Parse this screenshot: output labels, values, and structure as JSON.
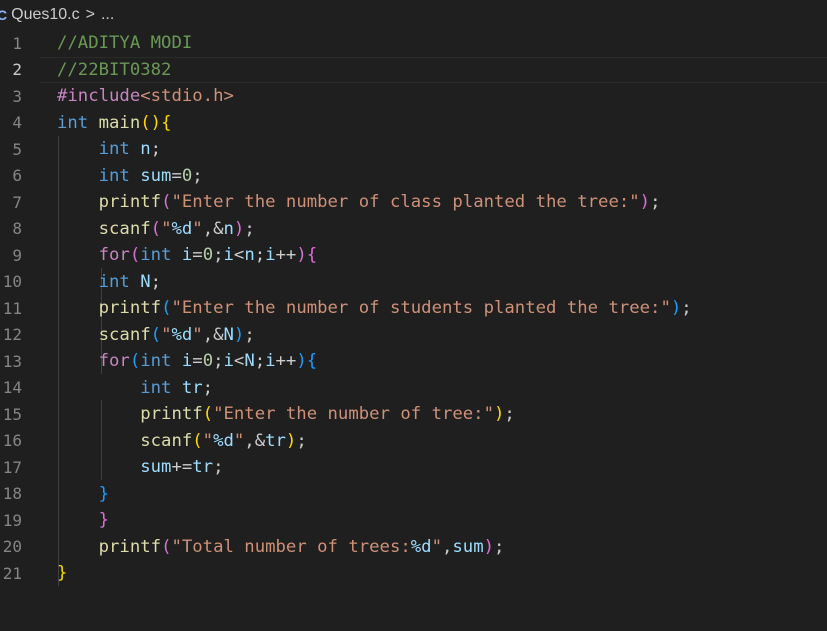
{
  "breadcrumb": {
    "icon": "c-file-icon",
    "icon_glyph": "C",
    "file": "Ques10.c",
    "separator": ">",
    "more": "..."
  },
  "editor": {
    "current_line": 2,
    "lines": [
      {
        "num": "1",
        "tokens": [
          {
            "t": "//ADITYA MODI",
            "c": "t-comment"
          }
        ]
      },
      {
        "num": "2",
        "tokens": [
          {
            "t": "//22BIT0382",
            "c": "t-comment"
          }
        ]
      },
      {
        "num": "3",
        "tokens": [
          {
            "t": "#include",
            "c": "t-inc"
          },
          {
            "t": "<stdio.h>",
            "c": "t-str"
          }
        ]
      },
      {
        "num": "4",
        "tokens": [
          {
            "t": "int",
            "c": "t-kw"
          },
          {
            "t": " ",
            "c": "t-punc"
          },
          {
            "t": "main",
            "c": "t-fn"
          },
          {
            "t": "()",
            "c": "t-br1"
          },
          {
            "t": "{",
            "c": "t-br1"
          }
        ]
      },
      {
        "num": "5",
        "tokens": [
          {
            "t": "    ",
            "c": "t-punc"
          },
          {
            "t": "int",
            "c": "t-kw"
          },
          {
            "t": " ",
            "c": "t-punc"
          },
          {
            "t": "n",
            "c": "t-var"
          },
          {
            "t": ";",
            "c": "t-punc"
          }
        ]
      },
      {
        "num": "6",
        "tokens": [
          {
            "t": "    ",
            "c": "t-punc"
          },
          {
            "t": "int",
            "c": "t-kw"
          },
          {
            "t": " ",
            "c": "t-punc"
          },
          {
            "t": "sum",
            "c": "t-var"
          },
          {
            "t": "=",
            "c": "t-punc"
          },
          {
            "t": "0",
            "c": "t-num"
          },
          {
            "t": ";",
            "c": "t-punc"
          }
        ]
      },
      {
        "num": "7",
        "tokens": [
          {
            "t": "    ",
            "c": "t-punc"
          },
          {
            "t": "printf",
            "c": "t-fn"
          },
          {
            "t": "(",
            "c": "t-br2"
          },
          {
            "t": "\"Enter the number of class planted the tree:\"",
            "c": "t-str"
          },
          {
            "t": ")",
            "c": "t-br2"
          },
          {
            "t": ";",
            "c": "t-punc"
          }
        ]
      },
      {
        "num": "8",
        "tokens": [
          {
            "t": "    ",
            "c": "t-punc"
          },
          {
            "t": "scanf",
            "c": "t-fn"
          },
          {
            "t": "(",
            "c": "t-br2"
          },
          {
            "t": "\"",
            "c": "t-str"
          },
          {
            "t": "%d",
            "c": "t-var"
          },
          {
            "t": "\"",
            "c": "t-str"
          },
          {
            "t": ",&",
            "c": "t-punc"
          },
          {
            "t": "n",
            "c": "t-var"
          },
          {
            "t": ")",
            "c": "t-br2"
          },
          {
            "t": ";",
            "c": "t-punc"
          }
        ]
      },
      {
        "num": "9",
        "tokens": [
          {
            "t": "    ",
            "c": "t-punc"
          },
          {
            "t": "for",
            "c": "t-ctrl"
          },
          {
            "t": "(",
            "c": "t-br2"
          },
          {
            "t": "int",
            "c": "t-kw"
          },
          {
            "t": " ",
            "c": "t-punc"
          },
          {
            "t": "i",
            "c": "t-var"
          },
          {
            "t": "=",
            "c": "t-punc"
          },
          {
            "t": "0",
            "c": "t-num"
          },
          {
            "t": ";",
            "c": "t-punc"
          },
          {
            "t": "i",
            "c": "t-var"
          },
          {
            "t": "<",
            "c": "t-punc"
          },
          {
            "t": "n",
            "c": "t-var"
          },
          {
            "t": ";",
            "c": "t-punc"
          },
          {
            "t": "i",
            "c": "t-var"
          },
          {
            "t": "++",
            "c": "t-punc"
          },
          {
            "t": ")",
            "c": "t-br2"
          },
          {
            "t": "{",
            "c": "t-br2"
          }
        ]
      },
      {
        "num": "10",
        "tokens": [
          {
            "t": "    ",
            "c": "t-punc"
          },
          {
            "t": "int",
            "c": "t-kw"
          },
          {
            "t": " ",
            "c": "t-punc"
          },
          {
            "t": "N",
            "c": "t-var"
          },
          {
            "t": ";",
            "c": "t-punc"
          }
        ]
      },
      {
        "num": "11",
        "tokens": [
          {
            "t": "    ",
            "c": "t-punc"
          },
          {
            "t": "printf",
            "c": "t-fn"
          },
          {
            "t": "(",
            "c": "t-br3"
          },
          {
            "t": "\"Enter the number of students planted the tree:\"",
            "c": "t-str"
          },
          {
            "t": ")",
            "c": "t-br3"
          },
          {
            "t": ";",
            "c": "t-punc"
          }
        ]
      },
      {
        "num": "12",
        "tokens": [
          {
            "t": "    ",
            "c": "t-punc"
          },
          {
            "t": "scanf",
            "c": "t-fn"
          },
          {
            "t": "(",
            "c": "t-br3"
          },
          {
            "t": "\"",
            "c": "t-str"
          },
          {
            "t": "%d",
            "c": "t-var"
          },
          {
            "t": "\"",
            "c": "t-str"
          },
          {
            "t": ",&",
            "c": "t-punc"
          },
          {
            "t": "N",
            "c": "t-var"
          },
          {
            "t": ")",
            "c": "t-br3"
          },
          {
            "t": ";",
            "c": "t-punc"
          }
        ]
      },
      {
        "num": "13",
        "tokens": [
          {
            "t": "    ",
            "c": "t-punc"
          },
          {
            "t": "for",
            "c": "t-ctrl"
          },
          {
            "t": "(",
            "c": "t-br3"
          },
          {
            "t": "int",
            "c": "t-kw"
          },
          {
            "t": " ",
            "c": "t-punc"
          },
          {
            "t": "i",
            "c": "t-var"
          },
          {
            "t": "=",
            "c": "t-punc"
          },
          {
            "t": "0",
            "c": "t-num"
          },
          {
            "t": ";",
            "c": "t-punc"
          },
          {
            "t": "i",
            "c": "t-var"
          },
          {
            "t": "<",
            "c": "t-punc"
          },
          {
            "t": "N",
            "c": "t-var"
          },
          {
            "t": ";",
            "c": "t-punc"
          },
          {
            "t": "i",
            "c": "t-var"
          },
          {
            "t": "++",
            "c": "t-punc"
          },
          {
            "t": ")",
            "c": "t-br3"
          },
          {
            "t": "{",
            "c": "t-br3"
          }
        ]
      },
      {
        "num": "14",
        "tokens": [
          {
            "t": "        ",
            "c": "t-punc"
          },
          {
            "t": "int",
            "c": "t-kw"
          },
          {
            "t": " ",
            "c": "t-punc"
          },
          {
            "t": "tr",
            "c": "t-var"
          },
          {
            "t": ";",
            "c": "t-punc"
          }
        ]
      },
      {
        "num": "15",
        "tokens": [
          {
            "t": "        ",
            "c": "t-punc"
          },
          {
            "t": "printf",
            "c": "t-fn"
          },
          {
            "t": "(",
            "c": "t-br1"
          },
          {
            "t": "\"Enter the number of tree:\"",
            "c": "t-str"
          },
          {
            "t": ")",
            "c": "t-br1"
          },
          {
            "t": ";",
            "c": "t-punc"
          }
        ]
      },
      {
        "num": "16",
        "tokens": [
          {
            "t": "        ",
            "c": "t-punc"
          },
          {
            "t": "scanf",
            "c": "t-fn"
          },
          {
            "t": "(",
            "c": "t-br1"
          },
          {
            "t": "\"",
            "c": "t-str"
          },
          {
            "t": "%d",
            "c": "t-var"
          },
          {
            "t": "\"",
            "c": "t-str"
          },
          {
            "t": ",&",
            "c": "t-punc"
          },
          {
            "t": "tr",
            "c": "t-var"
          },
          {
            "t": ")",
            "c": "t-br1"
          },
          {
            "t": ";",
            "c": "t-punc"
          }
        ]
      },
      {
        "num": "17",
        "tokens": [
          {
            "t": "        ",
            "c": "t-punc"
          },
          {
            "t": "sum",
            "c": "t-var"
          },
          {
            "t": "+=",
            "c": "t-punc"
          },
          {
            "t": "tr",
            "c": "t-var"
          },
          {
            "t": ";",
            "c": "t-punc"
          }
        ]
      },
      {
        "num": "18",
        "tokens": [
          {
            "t": "    ",
            "c": "t-punc"
          },
          {
            "t": "}",
            "c": "t-br3"
          }
        ]
      },
      {
        "num": "19",
        "tokens": [
          {
            "t": "    ",
            "c": "t-punc"
          },
          {
            "t": "}",
            "c": "t-br2"
          }
        ]
      },
      {
        "num": "20",
        "tokens": [
          {
            "t": "    ",
            "c": "t-punc"
          },
          {
            "t": "printf",
            "c": "t-fn"
          },
          {
            "t": "(",
            "c": "t-br2"
          },
          {
            "t": "\"Total number of trees:",
            "c": "t-str"
          },
          {
            "t": "%d",
            "c": "t-var"
          },
          {
            "t": "\"",
            "c": "t-str"
          },
          {
            "t": ",",
            "c": "t-punc"
          },
          {
            "t": "sum",
            "c": "t-var"
          },
          {
            "t": ")",
            "c": "t-br2"
          },
          {
            "t": ";",
            "c": "t-punc"
          }
        ]
      },
      {
        "num": "21",
        "tokens": [
          {
            "t": "}",
            "c": "t-br1"
          }
        ]
      }
    ]
  }
}
